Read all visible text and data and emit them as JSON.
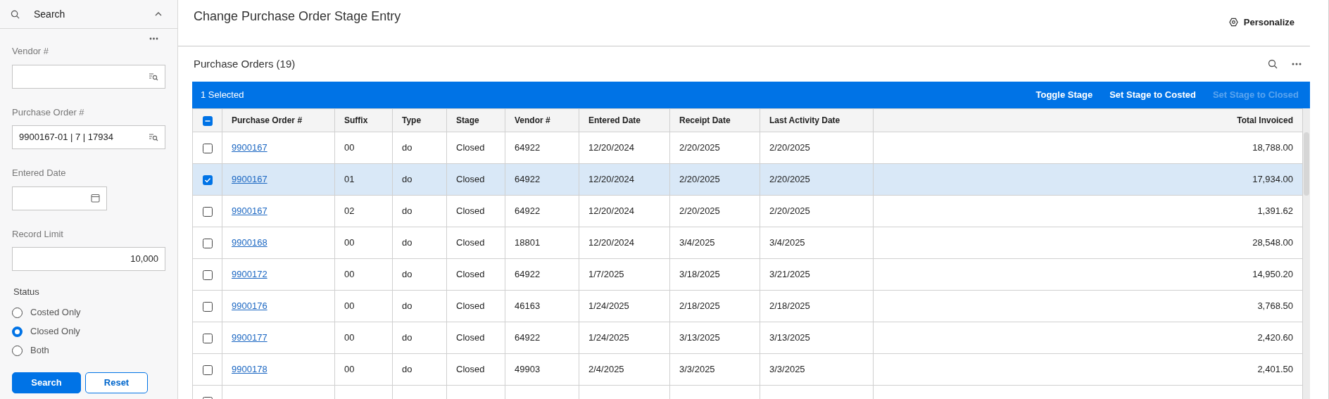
{
  "sidebar": {
    "title": "Search",
    "expanded": true,
    "fields": [
      {
        "kind": "lookup",
        "label": "Vendor #"
      },
      {
        "kind": "lookup",
        "label": "Purchase Order #",
        "value": "9900167-01 | 7 | 17934"
      },
      {
        "kind": "date",
        "label": "Entered Date"
      },
      {
        "kind": "number",
        "label": "Record Limit",
        "value": "10,000"
      }
    ],
    "status": {
      "label": "Status",
      "options": [
        {
          "label": "Costed Only",
          "selected": false
        },
        {
          "label": "Closed Only",
          "selected": true
        },
        {
          "label": "Both",
          "selected": false
        }
      ]
    },
    "buttons": [
      {
        "label": "Search",
        "kind": "primary"
      },
      {
        "label": "Reset",
        "kind": "secondary"
      }
    ]
  },
  "page": {
    "title": "Change Purchase Order Stage Entry",
    "personalize": "Personalize"
  },
  "grid": {
    "title": "Purchase Orders (19)",
    "selection": "1 Selected",
    "actions": [
      {
        "label": "Toggle Stage",
        "disabled": false
      },
      {
        "label": "Set Stage to Costed",
        "disabled": false
      },
      {
        "label": "Set Stage to Closed",
        "disabled": true
      }
    ],
    "select_all": {
      "indeterminate": true
    },
    "columns": [
      "Purchase Order #",
      "Suffix",
      "Type",
      "Stage",
      "Vendor #",
      "Entered Date",
      "Receipt Date",
      "Last Activity Date",
      "Total Invoiced"
    ],
    "rows": [
      {
        "selected": false,
        "cells": [
          "9900167",
          "00",
          "do",
          "Closed",
          "64922",
          "12/20/2024",
          "2/20/2025",
          "2/20/2025",
          "18,788.00"
        ]
      },
      {
        "selected": true,
        "cells": [
          "9900167",
          "01",
          "do",
          "Closed",
          "64922",
          "12/20/2024",
          "2/20/2025",
          "2/20/2025",
          "17,934.00"
        ]
      },
      {
        "selected": false,
        "cells": [
          "9900167",
          "02",
          "do",
          "Closed",
          "64922",
          "12/20/2024",
          "2/20/2025",
          "2/20/2025",
          "1,391.62"
        ]
      },
      {
        "selected": false,
        "cells": [
          "9900168",
          "00",
          "do",
          "Closed",
          "18801",
          "12/20/2024",
          "3/4/2025",
          "3/4/2025",
          "28,548.00"
        ]
      },
      {
        "selected": false,
        "cells": [
          "9900172",
          "00",
          "do",
          "Closed",
          "64922",
          "1/7/2025",
          "3/18/2025",
          "3/21/2025",
          "14,950.20"
        ]
      },
      {
        "selected": false,
        "cells": [
          "9900176",
          "00",
          "do",
          "Closed",
          "46163",
          "1/24/2025",
          "2/18/2025",
          "2/18/2025",
          "3,768.50"
        ]
      },
      {
        "selected": false,
        "cells": [
          "9900177",
          "00",
          "do",
          "Closed",
          "64922",
          "1/24/2025",
          "3/13/2025",
          "3/13/2025",
          "2,420.60"
        ]
      },
      {
        "selected": false,
        "cells": [
          "9900178",
          "00",
          "do",
          "Closed",
          "49903",
          "2/4/2025",
          "3/3/2025",
          "3/3/2025",
          "2,401.50"
        ]
      },
      {
        "selected": false,
        "cells": []
      }
    ]
  }
}
